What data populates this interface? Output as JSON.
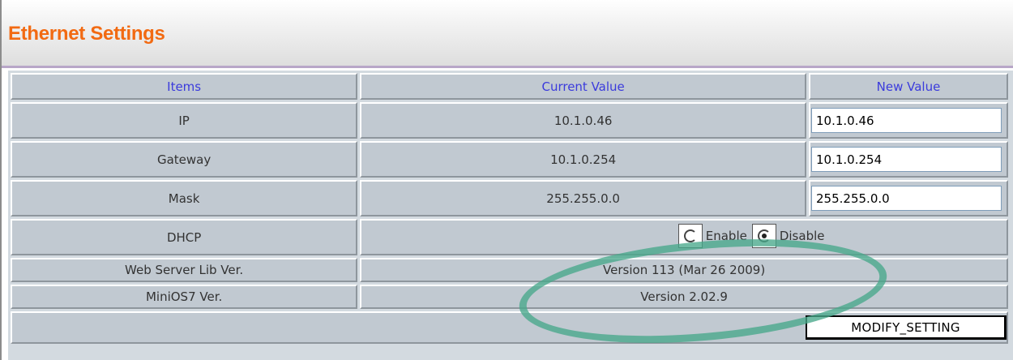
{
  "header": {
    "title": "Ethernet Settings"
  },
  "table": {
    "columns": [
      "Items",
      "Current Value",
      "New Value"
    ],
    "rows": {
      "ip": {
        "label": "IP",
        "current": "10.1.0.46",
        "new": "10.1.0.46"
      },
      "gateway": {
        "label": "Gateway",
        "current": "10.1.0.254",
        "new": "10.1.0.254"
      },
      "mask": {
        "label": "Mask",
        "current": "255.255.0.0",
        "new": "255.255.0.0"
      },
      "dhcp": {
        "label": "DHCP",
        "enable_label": "Enable",
        "disable_label": "Disable",
        "selected": "Disable"
      },
      "web_server": {
        "label": "Web Server Lib Ver.",
        "current": "Version 113 (Mar 26 2009)"
      },
      "minios": {
        "label": "MiniOS7 Ver.",
        "current": "Version 2.02.9"
      }
    }
  },
  "actions": {
    "modify_label": "MODIFY_SETTING"
  },
  "colors": {
    "title": "#f26a12",
    "header_text": "#3b3bdc",
    "cell_bg": "#c1c9d1",
    "annotation": "#48a88a"
  }
}
